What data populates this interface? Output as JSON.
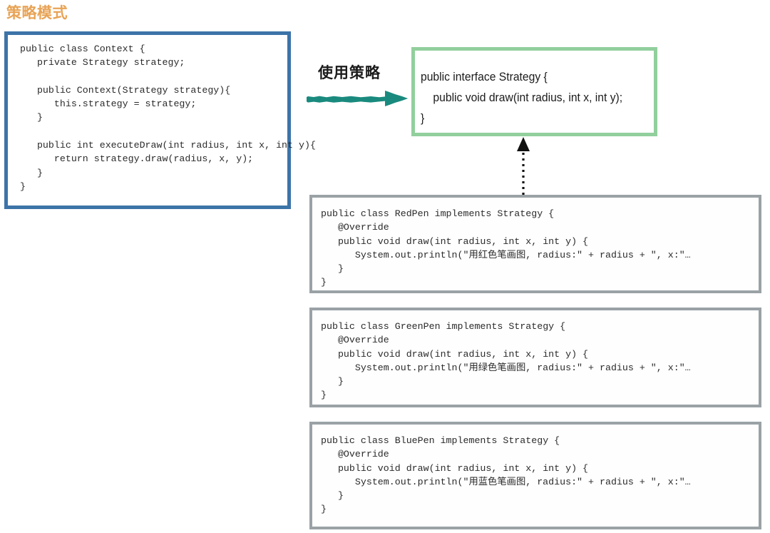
{
  "page": {
    "title": "策略模式",
    "title_color": "#e8a355",
    "background": "#ffffff"
  },
  "diagram": {
    "type": "uml-class-diagram",
    "context_box": {
      "name": "Context",
      "border_color": "#3d74a8",
      "code": "public class Context {\n   private Strategy strategy;\n\n   public Context(Strategy strategy){\n      this.strategy = strategy;\n   }\n\n   public int executeDraw(int radius, int x, int y){\n      return strategy.draw(radius, x, y);\n   }\n}"
    },
    "strategy_box": {
      "name": "Strategy",
      "border_color": "#92cf9d",
      "code": "public interface Strategy {\n    public void draw(int radius, int x, int y);\n}"
    },
    "implementations": [
      {
        "name": "RedPen",
        "border_color": "#9aa2a6",
        "code": "public class RedPen implements Strategy {\n   @Override\n   public void draw(int radius, int x, int y) {\n      System.out.println(\"用红色笔画图, radius:\" + radius + \", x:\"…\n   }\n}"
      },
      {
        "name": "GreenPen",
        "border_color": "#9aa2a6",
        "code": "public class GreenPen implements Strategy {\n   @Override\n   public void draw(int radius, int x, int y) {\n      System.out.println(\"用绿色笔画图, radius:\" + radius + \", x:\"…\n   }\n}"
      },
      {
        "name": "BluePen",
        "border_color": "#9aa2a6",
        "code": "public class BluePen implements Strategy {\n   @Override\n   public void draw(int radius, int x, int y) {\n      System.out.println(\"用蓝色笔画图, radius:\" + radius + \", x:\"…\n   }\n}"
      }
    ],
    "use_strategy_arrow": {
      "label": "使用策略",
      "color": "#1a8a7e",
      "direction": "right"
    },
    "realization_arrow": {
      "style": "dotted",
      "color": "#111111",
      "direction": "up"
    }
  }
}
